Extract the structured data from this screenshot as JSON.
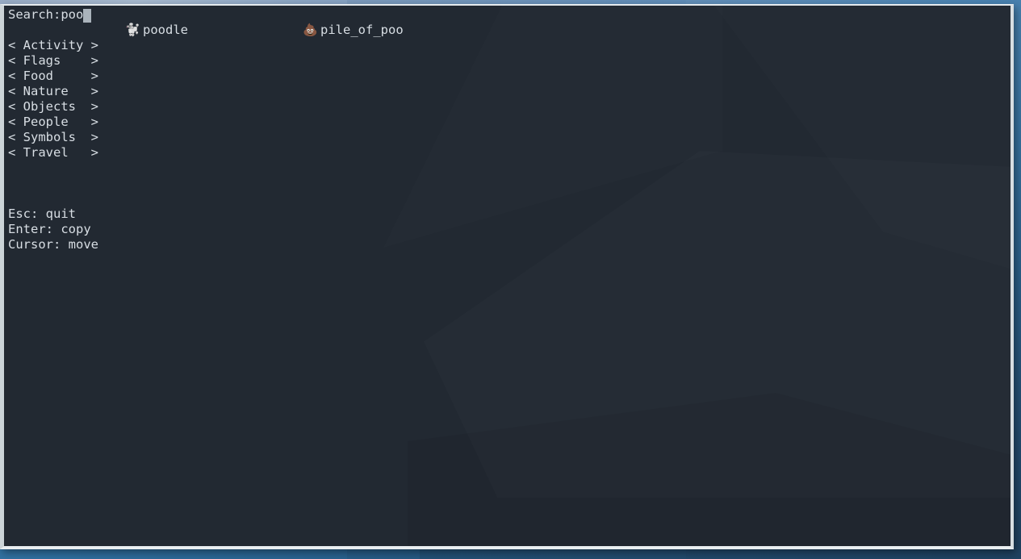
{
  "window": {
    "type": "terminal-emulator",
    "background_color": "#222932",
    "foreground_color": "#d8dee4",
    "border_color": "#ccd4d8"
  },
  "desktop": {
    "wallpaper_top_color": "#8ea4c0",
    "wallpaper_bottom_color": "#234a6d"
  },
  "search": {
    "label": "Search: ",
    "value": "poo",
    "placeholder": "",
    "cursor": "block"
  },
  "results": [
    {
      "emoji": "🐩",
      "emoji_name": "poodle-emoji",
      "label": "poodle",
      "column": 1
    },
    {
      "emoji": "💩",
      "emoji_name": "pile-of-poo-emoji",
      "label": "pile_of_poo",
      "column": 2
    }
  ],
  "categories": [
    {
      "prefix": "< ",
      "name": "Activity",
      "padded": "Activity",
      "suffix": " >"
    },
    {
      "prefix": "< ",
      "name": "Flags",
      "padded": "Flags   ",
      "suffix": " >"
    },
    {
      "prefix": "< ",
      "name": "Food",
      "padded": "Food    ",
      "suffix": " >"
    },
    {
      "prefix": "< ",
      "name": "Nature",
      "padded": "Nature  ",
      "suffix": " >"
    },
    {
      "prefix": "< ",
      "name": "Objects",
      "padded": "Objects ",
      "suffix": " >"
    },
    {
      "prefix": "< ",
      "name": "People",
      "padded": "People  ",
      "suffix": " >"
    },
    {
      "prefix": "< ",
      "name": "Symbols",
      "padded": "Symbols ",
      "suffix": " >"
    },
    {
      "prefix": "< ",
      "name": "Travel",
      "padded": "Travel  ",
      "suffix": " >"
    }
  ],
  "category_lines": [
    "< Activity >",
    "< Flags    >",
    "< Food     >",
    "< Nature   >",
    "< Objects  >",
    "< People   >",
    "< Symbols  >",
    "< Travel   >"
  ],
  "help": [
    {
      "key": "Esc",
      "action": "quit",
      "line": "Esc: quit"
    },
    {
      "key": "Enter",
      "action": "copy",
      "line": "Enter: copy"
    },
    {
      "key": "Cursor",
      "action": "move",
      "line": "Cursor: move"
    }
  ]
}
